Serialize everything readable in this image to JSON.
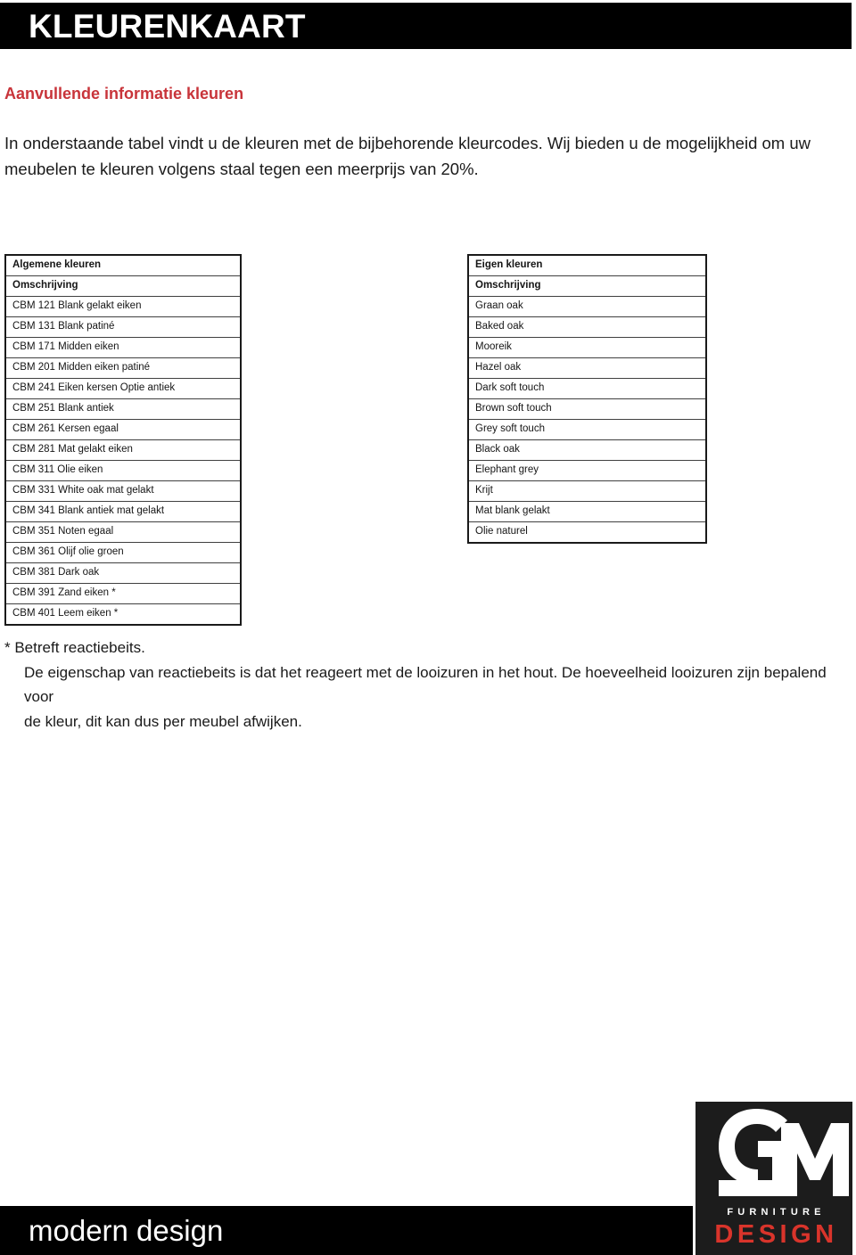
{
  "header": {
    "title": "KLEURENKAART"
  },
  "intro": {
    "heading": "Aanvullende informatie kleuren",
    "paragraph": "In onderstaande tabel vindt u de kleuren met de bijbehorende kleurcodes. Wij bieden u de mogelijkheid om uw meubelen te kleuren volgens staal tegen een meerprijs  van 20%."
  },
  "tables": {
    "general": {
      "title": "Algemene kleuren",
      "column_header": "Omschrijving",
      "rows": [
        "CBM 121 Blank gelakt eiken",
        "CBM 131 Blank patiné",
        "CBM 171 Midden eiken",
        "CBM 201 Midden eiken patiné",
        "CBM 241 Eiken kersen Optie antiek",
        "CBM 251 Blank antiek",
        "CBM 261 Kersen egaal",
        "CBM 281 Mat gelakt eiken",
        "CBM 311 Olie eiken",
        "CBM 331 White oak mat gelakt",
        "CBM 341 Blank antiek mat gelakt",
        "CBM 351 Noten egaal",
        "CBM 361 Olijf olie groen",
        "CBM 381 Dark oak",
        "CBM 391 Zand eiken *",
        "CBM 401 Leem eiken *"
      ]
    },
    "own": {
      "title": "Eigen kleuren",
      "column_header": "Omschrijving",
      "rows": [
        "Graan oak",
        "Baked oak",
        "Mooreik",
        "Hazel oak",
        "Dark soft touch",
        "Brown soft touch",
        "Grey soft touch",
        "Black oak",
        "Elephant grey",
        "Krijt",
        "Mat blank gelakt",
        "Olie naturel"
      ]
    }
  },
  "footnote": {
    "line1": "* Betreft reactiebeits.",
    "line2": "De eigenschap van reactiebeits is dat het reageert met de looizuren in het hout. De hoeveelheid looizuren zijn bepalend voor",
    "line3": "de kleur, dit kan dus per meubel afwijken."
  },
  "footer": {
    "tagline": "modern design",
    "logo": {
      "monogram": "GM",
      "furniture": "FURNITURE",
      "design": "DESIGN"
    }
  },
  "colors": {
    "accent_red": "#C8343A",
    "logo_red": "#D9342B",
    "bar_black": "#000000",
    "logo_bg": "#1C1C1C"
  }
}
